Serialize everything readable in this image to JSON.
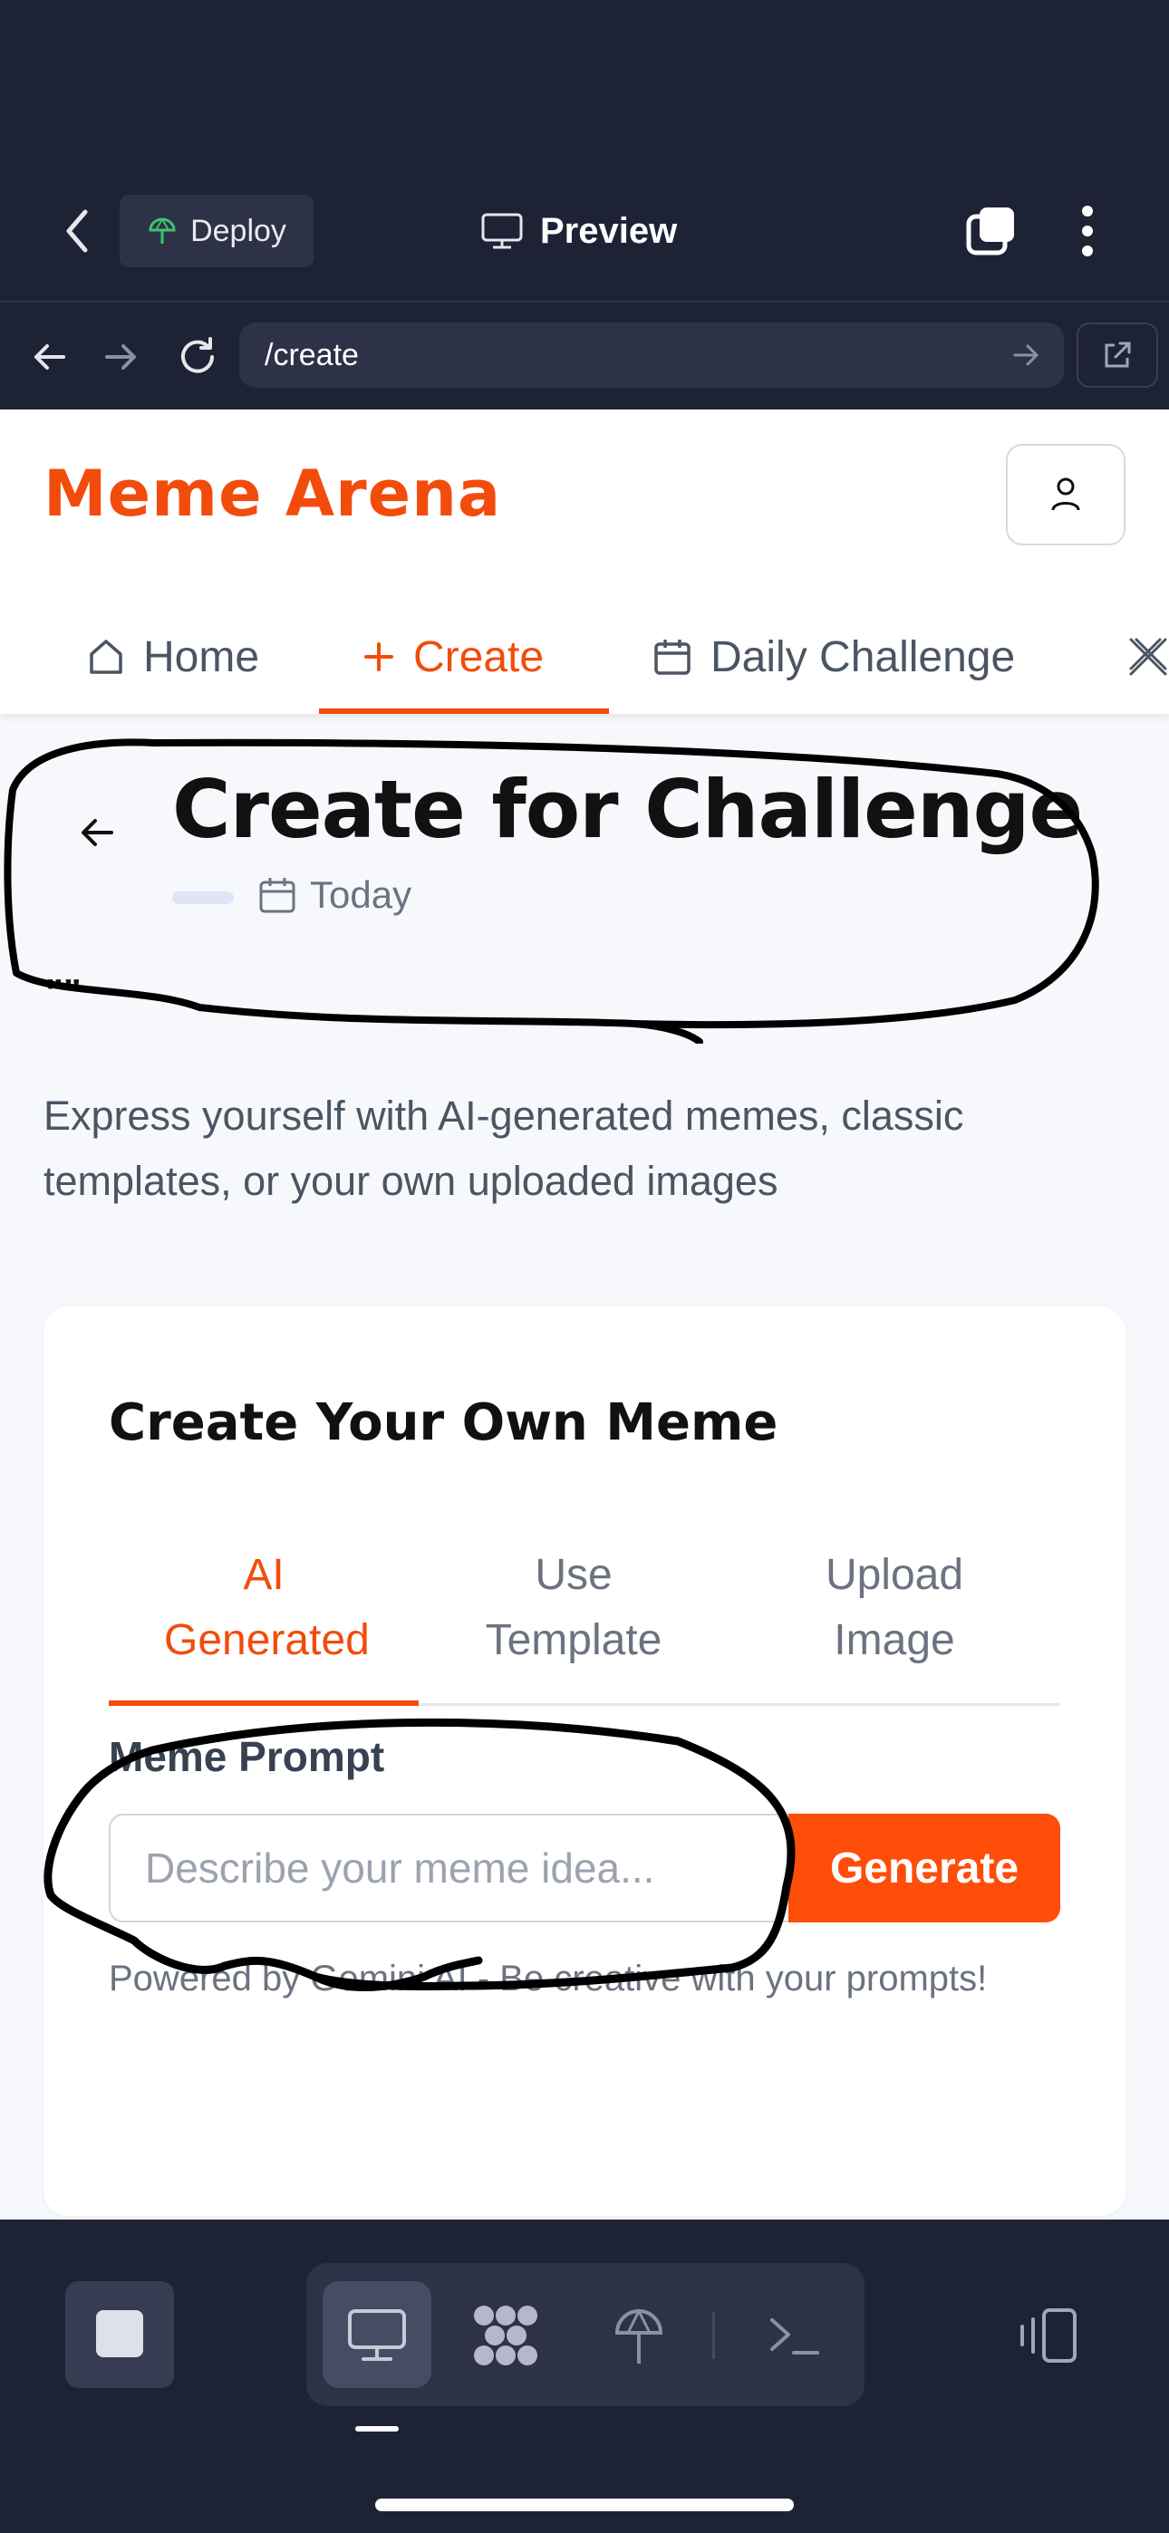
{
  "browser": {
    "deploy_label": "Deploy",
    "preview_label": "Preview",
    "url": "/create"
  },
  "app": {
    "brand": "Meme Arena",
    "nav": [
      {
        "label": "Home"
      },
      {
        "label": "Create",
        "active": true
      },
      {
        "label": "Daily Challenge"
      }
    ]
  },
  "challenge": {
    "title": "Create for Challenge",
    "date_label": "Today",
    "quotes": "\"\""
  },
  "description": "Express yourself with AI-generated memes, classic templates, or your own uploaded images",
  "card": {
    "title": "Create Your Own Meme",
    "modes": [
      {
        "label": "AI Generated",
        "active": true
      },
      {
        "label": "Use Template"
      },
      {
        "label": "Upload Image"
      }
    ],
    "prompt_label": "Meme Prompt",
    "prompt_placeholder": "Describe your meme idea...",
    "prompt_value": "",
    "generate_label": "Generate",
    "helper_text": "Powered by Gemini AI - Be creative with your prompts!"
  },
  "colors": {
    "accent": "#f24c0c",
    "chrome_bg": "#1e2235",
    "page_bg": "#f7f8fb"
  },
  "icons": [
    "back-chevron-icon",
    "deploy-icon",
    "monitor-icon",
    "tabs-icon",
    "more-vertical-icon",
    "arrow-left-icon",
    "arrow-right-icon",
    "reload-icon",
    "go-arrow-icon",
    "external-link-icon",
    "user-icon",
    "home-icon",
    "plus-icon",
    "calendar-icon",
    "close-icon",
    "stop-icon",
    "desktop-icon",
    "apps-icon",
    "deploy-icon",
    "terminal-icon",
    "devices-icon"
  ]
}
